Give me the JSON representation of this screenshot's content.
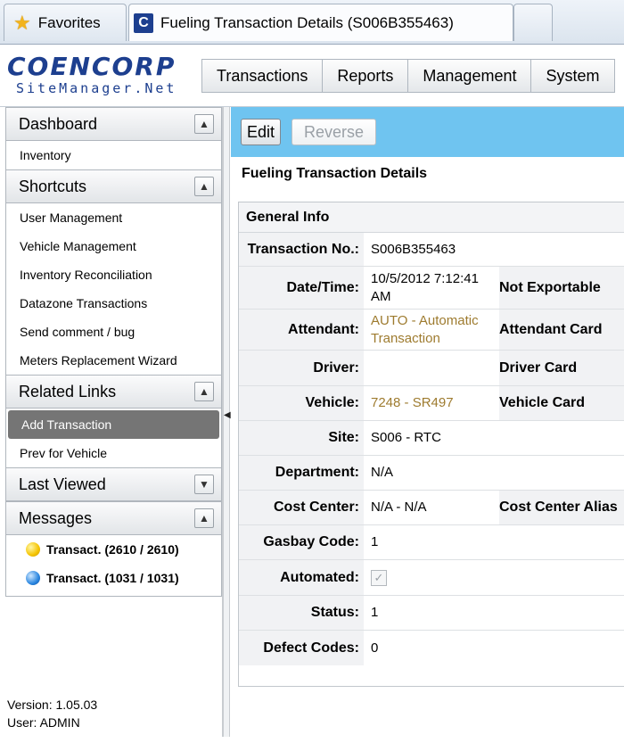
{
  "browser": {
    "favorites_tab": "Favorites",
    "active_tab": "Fueling Transaction Details (S006B355463)",
    "active_tab_icon": "C"
  },
  "header": {
    "logo_brand": "COENCORP",
    "logo_sub": "SiteManager.Net",
    "menu": [
      "Transactions",
      "Reports",
      "Management",
      "System"
    ]
  },
  "sidebar": {
    "dashboard": {
      "title": "Dashboard",
      "items": [
        "Inventory"
      ]
    },
    "shortcuts": {
      "title": "Shortcuts",
      "items": [
        "User Management",
        "Vehicle Management",
        "Inventory Reconciliation",
        "Datazone Transactions",
        "Send comment / bug",
        "Meters Replacement Wizard"
      ]
    },
    "related_links": {
      "title": "Related Links",
      "items": [
        "Add Transaction",
        "Prev for Vehicle"
      ]
    },
    "last_viewed": {
      "title": "Last Viewed"
    },
    "messages": {
      "title": "Messages",
      "items": [
        {
          "label": "Transact. (2610 / 2610)",
          "color": "#f5c400"
        },
        {
          "label": "Transact. (1031 / 1031)",
          "color": "#2a86e0"
        }
      ]
    },
    "version": "Version: 1.05.03",
    "user": "User: ADMIN"
  },
  "toolbar": {
    "edit": "Edit",
    "reverse": "Reverse"
  },
  "page_title": "Fueling Transaction Details",
  "general_info": {
    "title": "General Info",
    "transaction_no": {
      "label": "Transaction No.:",
      "value": "S006B355463"
    },
    "datetime": {
      "label": "Date/Time:",
      "value": "10/5/2012 7:12:41 AM",
      "right_label": "Not Exportable"
    },
    "attendant": {
      "label": "Attendant:",
      "value": "AUTO - Automatic Transaction",
      "right_label": "Attendant Card"
    },
    "driver": {
      "label": "Driver:",
      "value": "",
      "right_label": "Driver Card"
    },
    "vehicle": {
      "label": "Vehicle:",
      "value": "7248 - SR497",
      "right_label": "Vehicle Card"
    },
    "site": {
      "label": "Site:",
      "value": "S006 - RTC"
    },
    "department": {
      "label": "Department:",
      "value": "N/A"
    },
    "cost_center": {
      "label": "Cost Center:",
      "value": "N/A - N/A",
      "right_label": "Cost Center Alias"
    },
    "gasbay_code": {
      "label": "Gasbay Code:",
      "value": "1"
    },
    "automated": {
      "label": "Automated:",
      "checked": true
    },
    "status": {
      "label": "Status:",
      "value": "1"
    },
    "defect_codes": {
      "label": "Defect Codes:",
      "value": "0"
    }
  }
}
